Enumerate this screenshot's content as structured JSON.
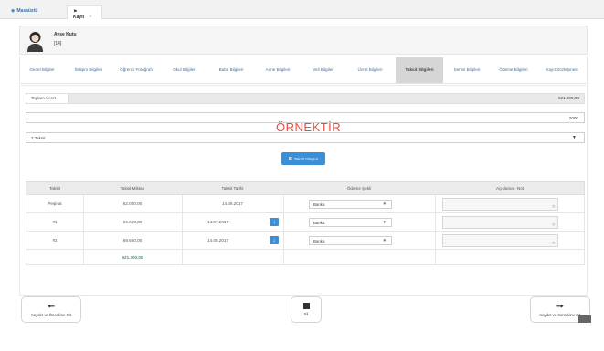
{
  "top_tabs": {
    "home": "Masaüstü",
    "register": "Kayıt",
    "close": "×"
  },
  "profile": {
    "name": "Ayşe Kutu",
    "id": "[14]"
  },
  "section_tabs": [
    {
      "label": "Genel Bilgiler"
    },
    {
      "label": "İletişim Bilgileri"
    },
    {
      "label": "Öğrenci Fotoğrafı"
    },
    {
      "label": "Okul Bilgileri"
    },
    {
      "label": "Baba Bilgileri"
    },
    {
      "label": "Anne Bilgileri"
    },
    {
      "label": "Veli Bilgileri"
    },
    {
      "label": "Ücret Bilgileri"
    },
    {
      "label": "Taksit Bilgileri"
    },
    {
      "label": "Servis Bilgileri"
    },
    {
      "label": "Ödeme Bilgileri"
    },
    {
      "label": "Kayıt Sözleşmesi"
    }
  ],
  "active_tab": "Taksit Bilgileri",
  "form": {
    "total_label": "Toplam Ücret",
    "total_value": "621.300,00",
    "amount_value": "2000",
    "installment_select": "2 Taksit",
    "watermark": "ÖRNEKTİR",
    "create_button": "Taksit Oluştur"
  },
  "table": {
    "headers": [
      "Taksit",
      "Taksit Miktarı",
      "Taksit Tarihi",
      "Ödeme Şekli",
      "Açıklama - Not"
    ],
    "rows": [
      {
        "taksit": "Peşinat",
        "miktar": "62.000,00",
        "tarih": "14.06.2017",
        "odeme": "Banka"
      },
      {
        "taksit": "#1",
        "miktar": "69.650,00",
        "tarih": "14.07.2017",
        "odeme": "Banka"
      },
      {
        "taksit": "#2",
        "miktar": "69.650,00",
        "tarih": "14.08.2017",
        "odeme": "Banka"
      }
    ],
    "total": "621.300,00"
  },
  "bottom": {
    "prev": "Kaydet ve Öncekine Git",
    "delete": "Sil",
    "next": "Kaydet ve Sonrakine Git"
  },
  "colors": {
    "accent": "#3a8fd6",
    "link": "#3a72a8",
    "watermark": "#e74c3c",
    "total_green": "#27ae60"
  }
}
